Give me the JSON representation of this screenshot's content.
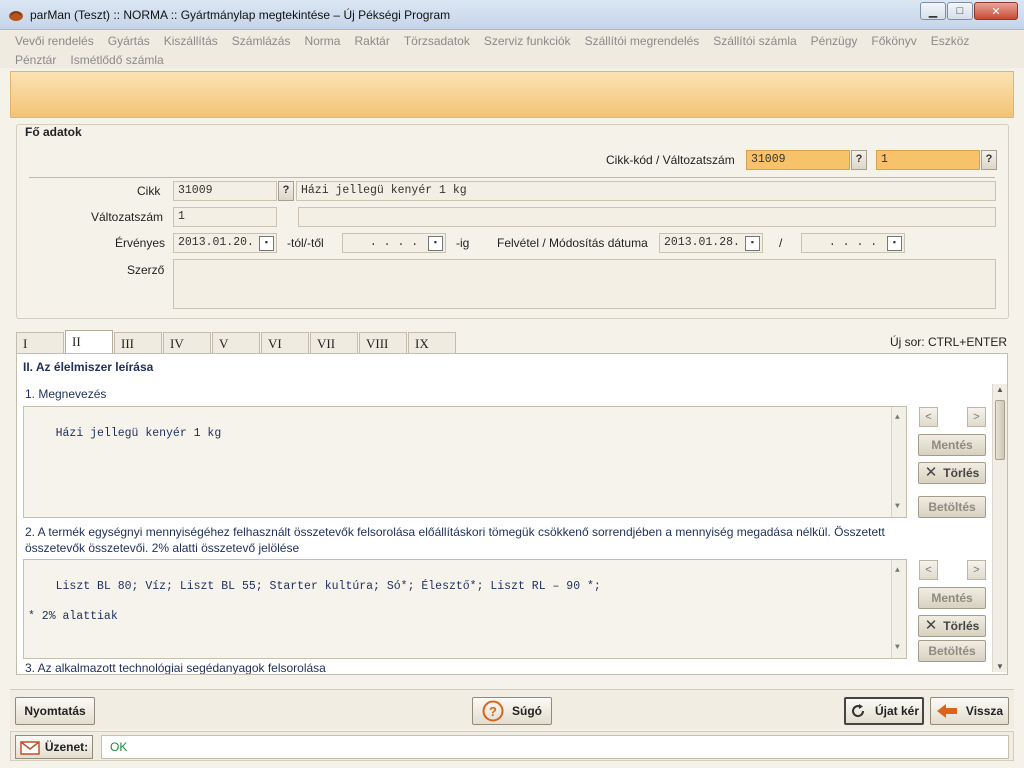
{
  "window": {
    "title": "parMan (Teszt) :: NORMA :: Gyártmánylap megtekintése  –  Új Pékségi Program",
    "minimize_icon": "minimize-icon",
    "maximize_icon": "maximize-icon",
    "close_icon": "close-icon"
  },
  "menu": {
    "items": [
      "Vevői rendelés",
      "Gyártás",
      "Kiszállítás",
      "Számlázás",
      "Norma",
      "Raktár",
      "Törzsadatok",
      "Szerviz funkciók",
      "Szállítói megrendelés",
      "Szállítói számla",
      "Pénzügy",
      "Főkönyv",
      "Eszköz",
      "Pénztár",
      "Ismétlődő számla"
    ]
  },
  "main": {
    "section_title": "Fő adatok",
    "cikkkod_label": "Cikk-kód / Változatszám",
    "cikkkod_value": "31009",
    "valtozat_value": "1",
    "cikk_label": "Cikk",
    "cikk_code": "31009",
    "cikk_name": "Házi jellegü kenyér 1 kg",
    "valtozatszam_label": "Változatszám",
    "valtozatszam_value": "1",
    "valtozatszam_desc": "",
    "ervenyes_label": "Érvényes",
    "ervenyes_from": "2013.01.20.",
    "tol_label": "-tól/-től",
    "ervenyes_to": ". . . .",
    "ig_label": "-ig",
    "felvetel_label": "Felvétel / Módosítás dátuma",
    "felvetel_date": "2013.01.28.",
    "slash": "/",
    "modositas_date": ". . . .",
    "szerzo_label": "Szerző",
    "szerzo_value": "",
    "q": "?"
  },
  "tabs": {
    "items": [
      "I",
      "II",
      "III",
      "IV",
      "V",
      "VI",
      "VII",
      "VIII",
      "IX"
    ],
    "active": "II",
    "hint": "Új sor: CTRL+ENTER"
  },
  "tab_content": {
    "title": "II. Az élelmiszer leírása",
    "fields": [
      {
        "label": "1. Megnevezés",
        "text": "Házi jellegü kenyér 1 kg"
      },
      {
        "label": "2. A termék egységnyi mennyiségéhez felhasznált összetevők felsorolása előállításkori tömegük csökkenő sorrendjében a mennyiség megadása nélkül. Összetett összetevők összetevői. 2% alatti összetevő jelölése",
        "text": "Liszt BL 80; Víz; Liszt BL 55; Starter kultúra; Só*; Élesztő*; Liszt RL – 90 *;\n\n* 2% alattiak"
      },
      {
        "label": "3. Az alkalmazott technológiai segédanyagok felsorolása",
        "text": ""
      }
    ],
    "buttons": {
      "prev": "<",
      "next": ">",
      "save": "Mentés",
      "delete": "Törlés",
      "load": "Betöltés"
    }
  },
  "footer": {
    "print": "Nyomtatás",
    "help": "Súgó",
    "request_new": "Újat kér",
    "back": "Vissza"
  },
  "status": {
    "message_label": "Üzenet:",
    "message": "OK"
  },
  "colors": {
    "accent_orange": "#f7c26a",
    "status_ok": "#1a8a3a",
    "back_arrow": "#d9651a"
  }
}
